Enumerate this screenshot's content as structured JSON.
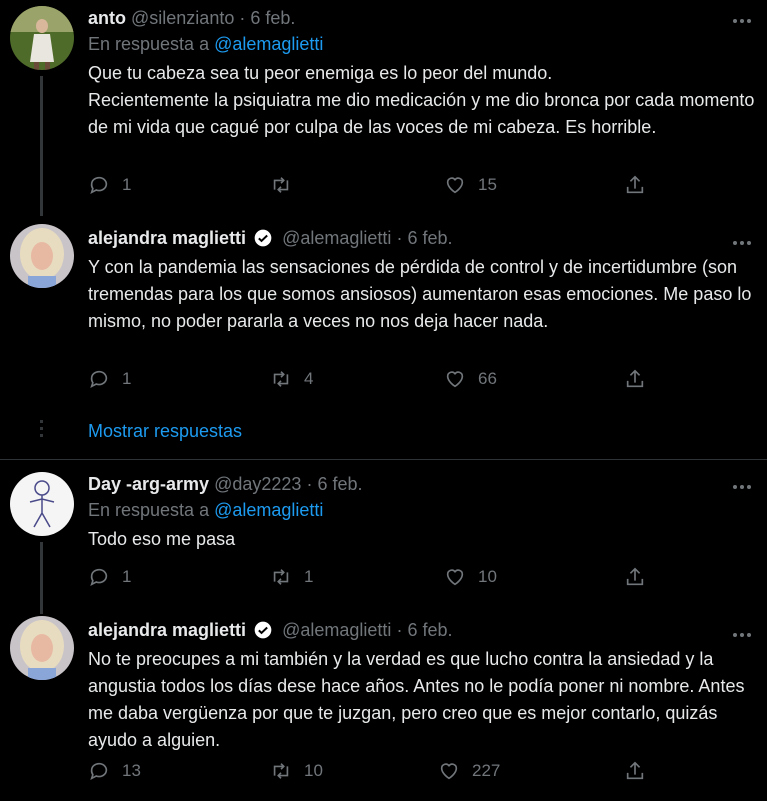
{
  "tweets": [
    {
      "name": "anto",
      "handle": "@silenzianto",
      "dot": "·",
      "date": "6 feb.",
      "reply_prefix": "En respuesta a",
      "reply_mention": "@alemaglietti",
      "text": "Que tu cabeza sea tu peor enemiga es lo peor del mundo.\nRecientemente la psiquiatra me dio medicación y me dio bronca por cada momento de mi vida que cagué por culpa de las voces de mi cabeza. Es horrible.",
      "replies": "1",
      "retweets": "",
      "likes": "15"
    },
    {
      "name": "alejandra maglietti",
      "handle": "@alemaglietti",
      "dot": "·",
      "date": "6 feb.",
      "text": "Y con la pandemia las sensaciones de pérdida de control y de incertidumbre (son tremendas para los que somos ansiosos) aumentaron esas emociones. Me paso lo mismo, no poder pararla a veces no nos deja hacer nada.",
      "replies": "1",
      "retweets": "4",
      "likes": "66"
    },
    {
      "name": "Day -arg-army",
      "handle": "@day2223",
      "dot": "·",
      "date": "6 feb.",
      "reply_prefix": "En respuesta a",
      "reply_mention": "@alemaglietti",
      "text": "Todo eso me pasa",
      "replies": "1",
      "retweets": "1",
      "likes": "10"
    },
    {
      "name": "alejandra maglietti",
      "handle": "@alemaglietti",
      "dot": "·",
      "date": "6 feb.",
      "text": "No te preocupes a mi también y la  verdad es que lucho contra la ansiedad y la angustia todos los días dese hace años. Antes no le podía poner ni nombre. Antes me daba vergüenza por que te juzgan, pero creo que es mejor contarlo, quizás ayudo a alguien.",
      "replies": "13",
      "retweets": "10",
      "likes": "227"
    }
  ],
  "show_replies": "Mostrar respuestas",
  "colors": {
    "accent": "#1d9bf0",
    "muted": "#71767b",
    "verified": "#ffffff"
  },
  "icons": [
    "reply-icon",
    "retweet-icon",
    "like-icon",
    "share-icon",
    "more-icon",
    "verified-badge-icon"
  ]
}
